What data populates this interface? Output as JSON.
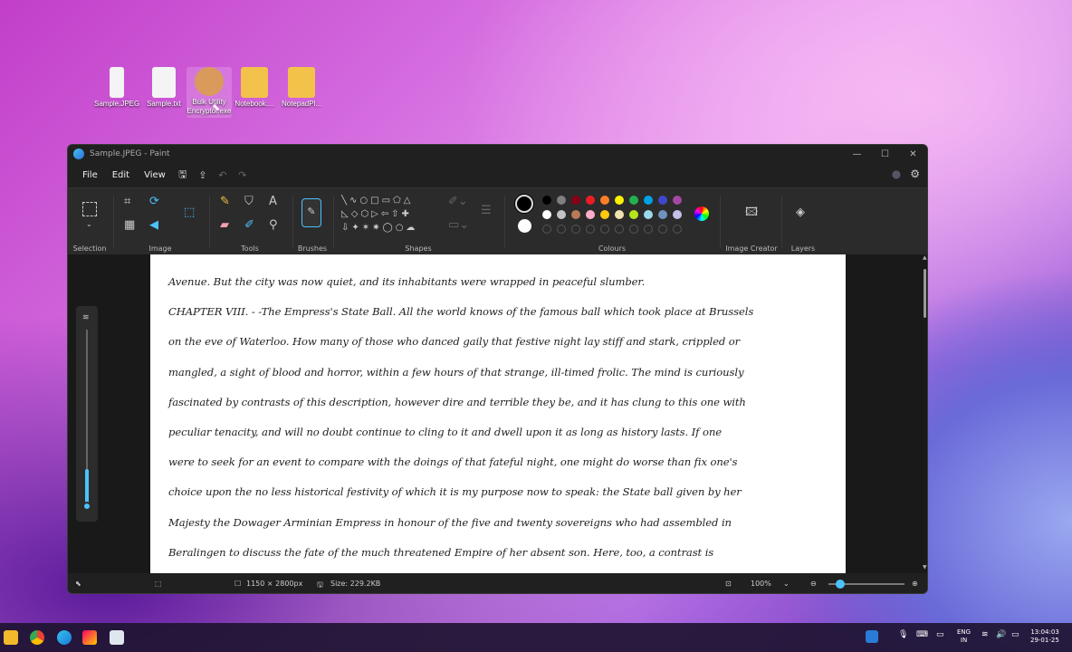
{
  "desktop": {
    "icons": [
      {
        "label": "Sample.JPEG"
      },
      {
        "label": "Sample.txt"
      },
      {
        "label": "Bulk Utility Encryptor.exe"
      },
      {
        "label": "Notebook...."
      },
      {
        "label": "NotepadPl..."
      }
    ]
  },
  "window": {
    "title": "Sample.JPEG - Paint"
  },
  "menu": {
    "file": "File",
    "edit": "Edit",
    "view": "View"
  },
  "ribbon": {
    "groups": {
      "selection": "Selection",
      "image": "Image",
      "tools": "Tools",
      "brushes": "Brushes",
      "shapes": "Shapes",
      "colours": "Colours",
      "image_creator": "Image Creator",
      "layers": "Layers"
    }
  },
  "palette": {
    "row1": [
      "#000000",
      "#7f7f7f",
      "#880015",
      "#ed1c24",
      "#ff7f27",
      "#fff200",
      "#22b14c",
      "#00a2e8",
      "#3f48cc",
      "#a349a4"
    ],
    "row2": [
      "#ffffff",
      "#c3c3c3",
      "#b97a57",
      "#ffaec9",
      "#ffc90e",
      "#efe4b0",
      "#b5e61d",
      "#99d9ea",
      "#7092be",
      "#c8bfe7"
    ],
    "primary": "#000000",
    "secondary": "#ffffff",
    "accent": "#4cc2ff"
  },
  "document": {
    "lines": [
      "Avenue. But the city was now quiet, and its inhabitants were wrapped in peaceful slumber.",
      "CHAPTER VIII. - -The Empress's State Ball. All the world knows of the famous ball which took place at Brussels",
      "on the eve of Waterloo. How many of those who danced gaily that festive night lay stiff and stark, crippled or",
      "mangled, a sight of blood and horror, within a few hours of that strange, ill-timed frolic. The mind is curiously",
      "fascinated by contrasts of this description, however dire and terrible they be, and it has clung to this one with",
      "peculiar tenacity, and will no doubt continue to cling to it and dwell upon it as long as history lasts. If one",
      "were to seek for an event to compare with the doings of that fateful night, one might do worse than fix one's",
      "choice upon the no less historical festivity of which it is my purpose now to speak: the State ball given by her",
      "Majesty the Dowager Arminian Empress in honour of the five and twenty sovereigns who had assembled in",
      "Beralingen to discuss the fate of the much threatened Empire of her absent son. Here, too, a contrast is"
    ]
  },
  "status": {
    "dimensions": "1150 × 2800px",
    "size": "Size: 229.2KB",
    "zoom": "100%"
  },
  "tray": {
    "lang1": "ENG",
    "lang2": "IN",
    "time": "13:04:03",
    "date": "29-01-25"
  }
}
